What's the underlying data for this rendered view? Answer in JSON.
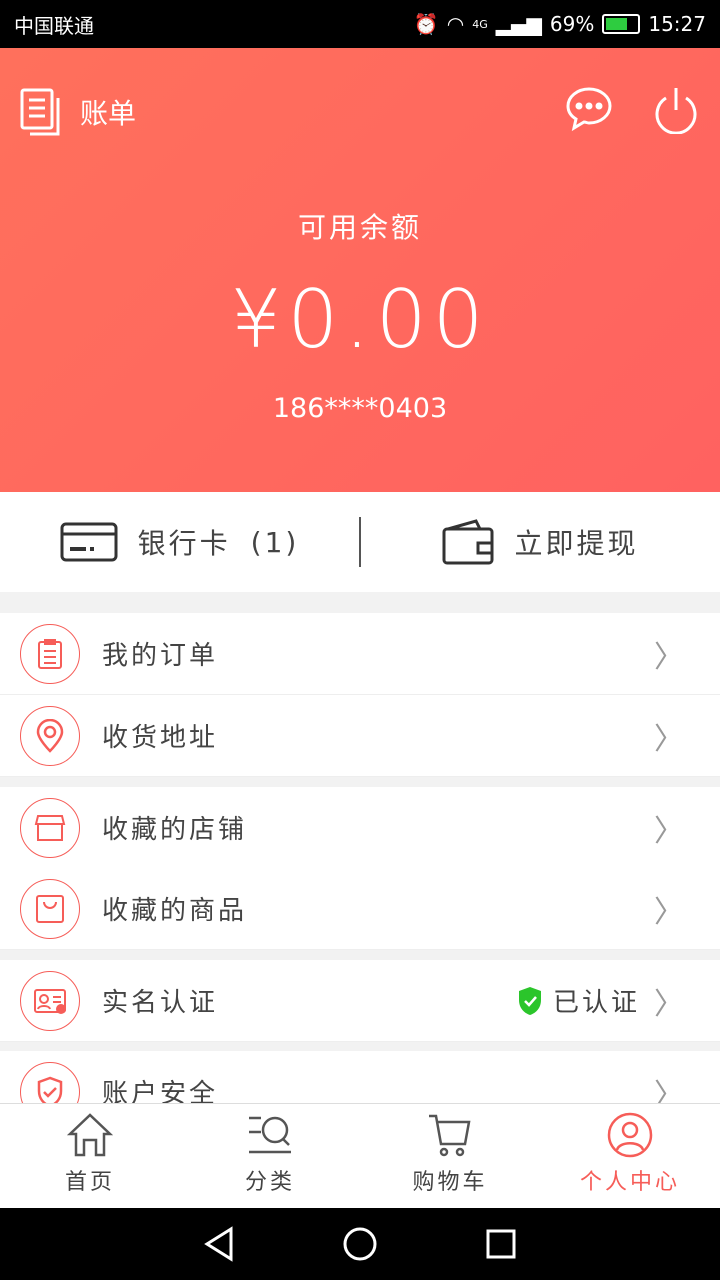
{
  "status_bar": {
    "carrier": "中国联通",
    "battery": "69%",
    "battery_level": 0.69,
    "time": "15:27",
    "network": "4G"
  },
  "header": {
    "title": "账单",
    "balance_label": "可用余额",
    "balance": "¥0.00",
    "phone": "186****0403",
    "bg_color": "#ff6a5e"
  },
  "bank": {
    "card_label": "银行卡",
    "card_count": "(1)",
    "withdraw_label": "立即提现"
  },
  "menu": [
    {
      "label": "我的订单",
      "icon": "clipboard-icon"
    },
    {
      "label": "收货地址",
      "icon": "location-pin-icon"
    },
    {
      "label": "收藏的店铺",
      "icon": "store-icon"
    },
    {
      "label": "收藏的商品",
      "icon": "shopping-bag-icon"
    },
    {
      "label": "实名认证",
      "icon": "id-card-icon",
      "status": "已认证"
    },
    {
      "label": "账户安全",
      "icon": "shield-icon"
    }
  ],
  "tabs": [
    {
      "label": "首页",
      "icon": "home-icon"
    },
    {
      "label": "分类",
      "icon": "category-search-icon"
    },
    {
      "label": "购物车",
      "icon": "cart-icon"
    },
    {
      "label": "个人中心",
      "icon": "user-icon",
      "active": true
    }
  ],
  "accent": "#f65d58"
}
